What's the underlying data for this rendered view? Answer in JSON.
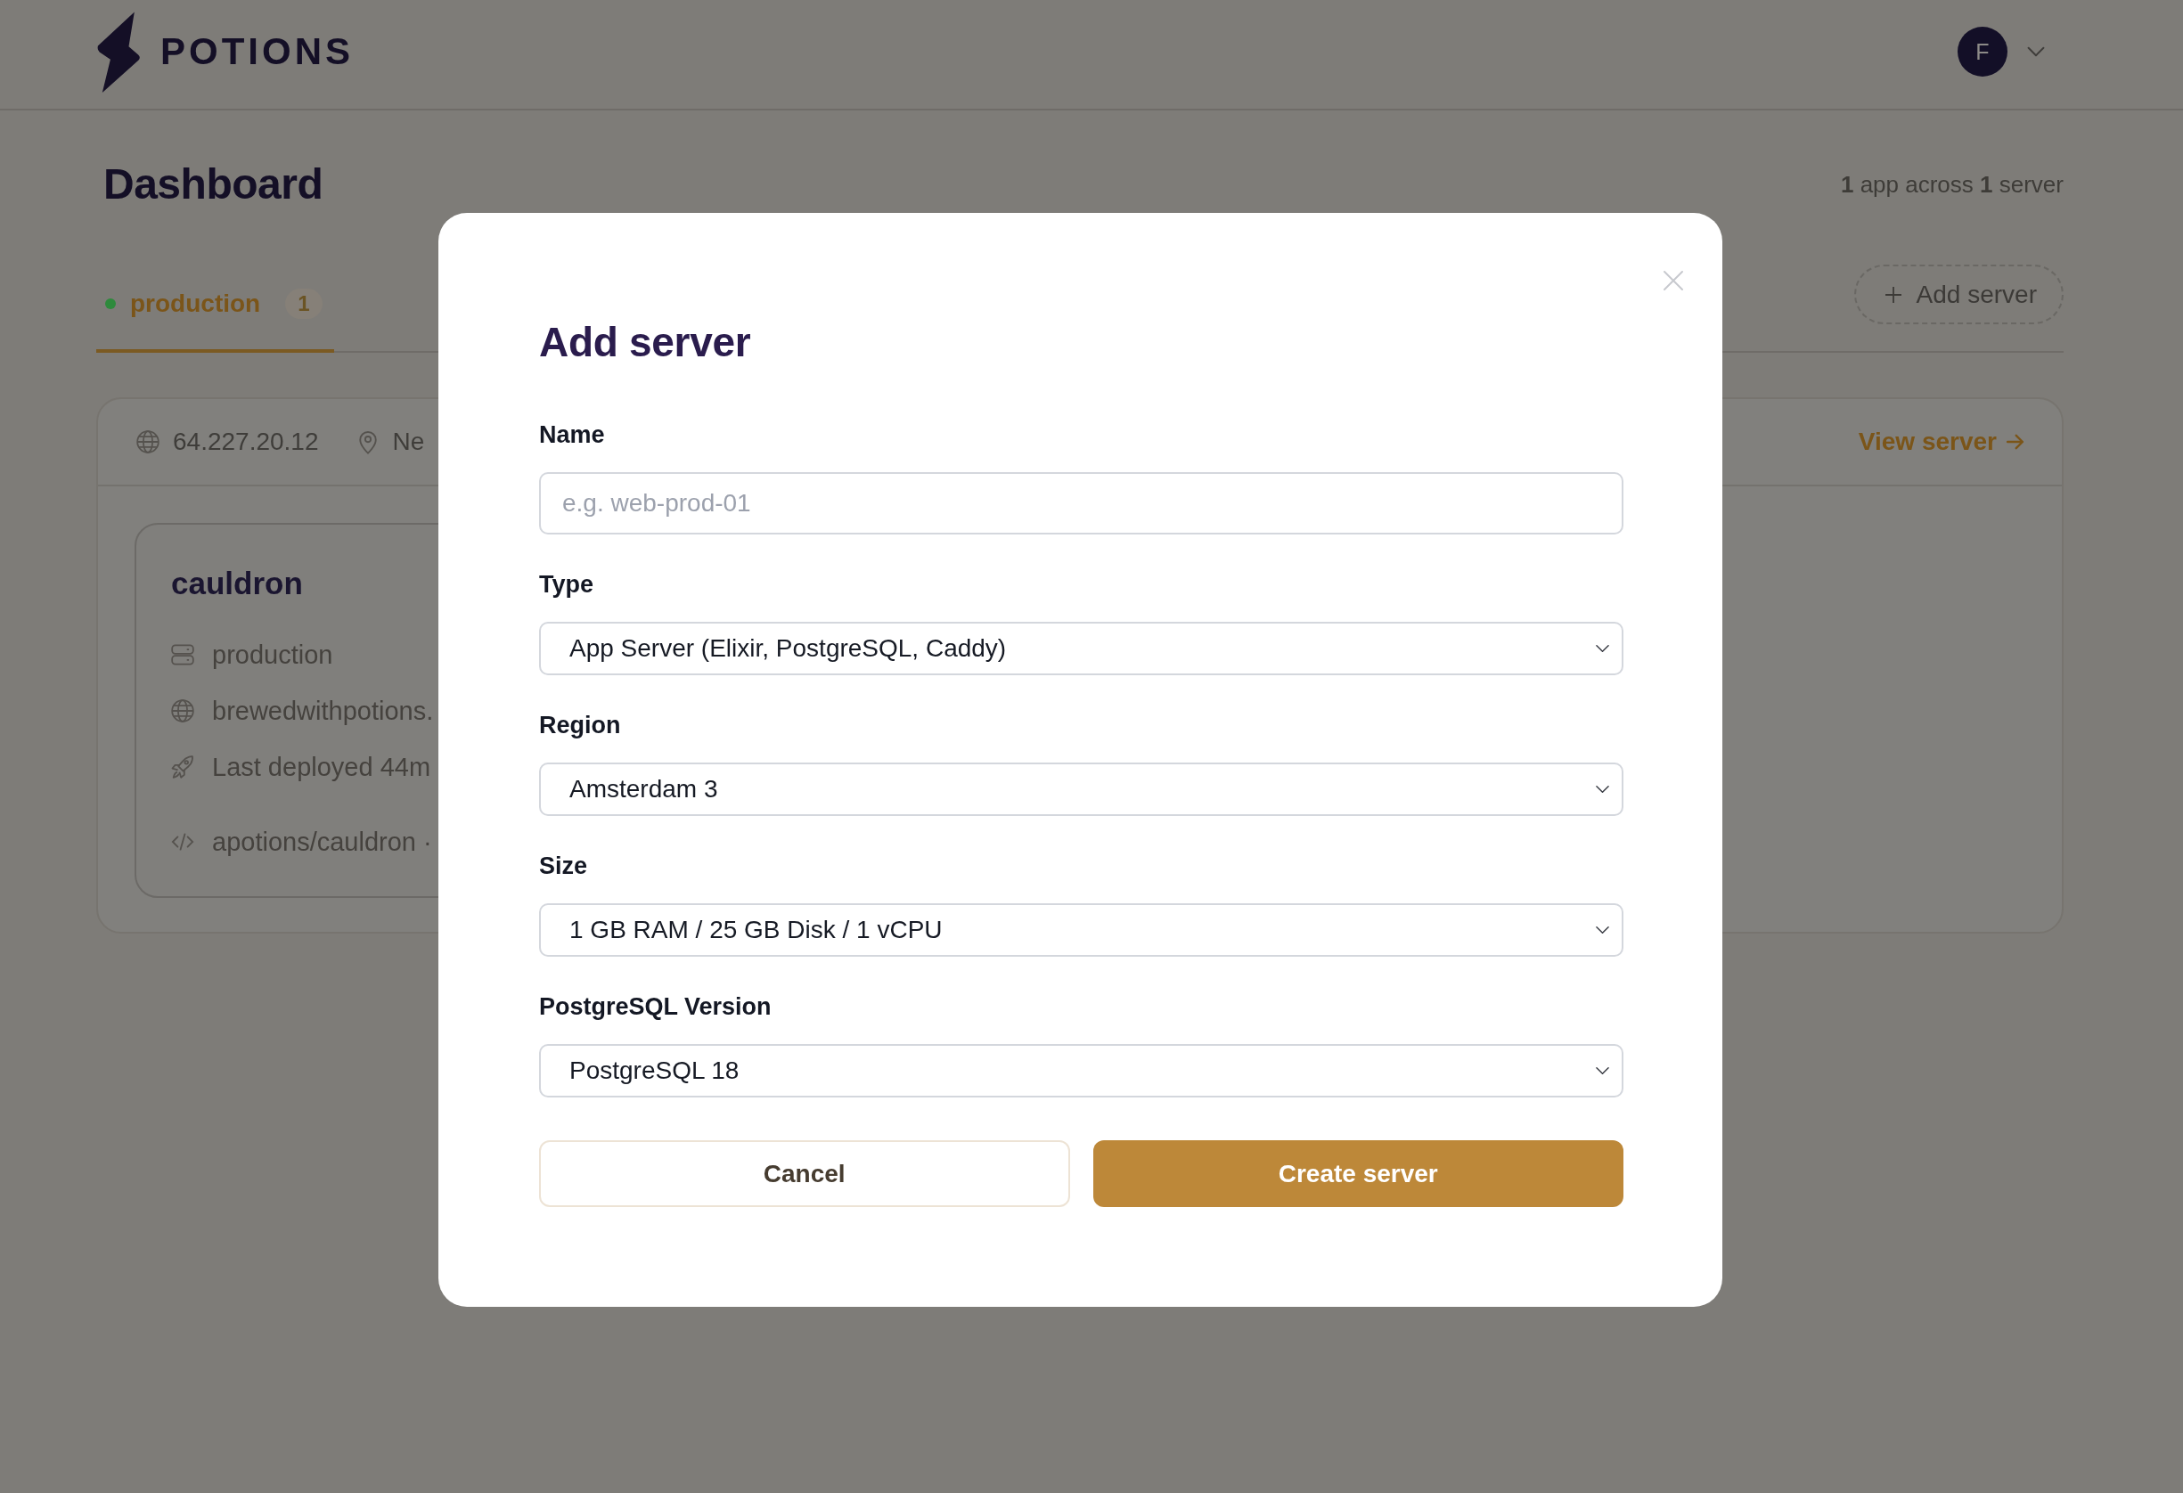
{
  "header": {
    "logo": "POTIONS",
    "avatar": "F"
  },
  "dashboard": {
    "title": "Dashboard",
    "summary": "**1** app across **1** server"
  },
  "tabs": [
    {
      "label": "production",
      "count": "1",
      "color": "#2e8a3c",
      "selected": true
    }
  ],
  "add_server_button": {
    "label": "Add server"
  },
  "server_card": {
    "ip": "64.227.20.12",
    "location": "Ne",
    "link": "View server",
    "apps": [
      {
        "name": "cauldron",
        "rows": [
          {
            "kind": "environment",
            "text": "production"
          },
          {
            "kind": "domain",
            "text": "brewedwithpotions."
          },
          {
            "kind": "deploy",
            "text": "Last deployed 44m"
          },
          {
            "kind": "repo",
            "text": "apotions/cauldron ·"
          }
        ]
      }
    ]
  },
  "modal": {
    "title": "Add server",
    "fields": [
      {
        "kind": "text",
        "label": "Name",
        "placeholder": "e.g. web-prod-01"
      },
      {
        "kind": "select",
        "label": "Type",
        "value": "App Server (Elixir, PostgreSQL, Caddy)"
      },
      {
        "kind": "select",
        "label": "Region",
        "value": "Amsterdam 3"
      },
      {
        "kind": "select",
        "label": "Size",
        "value": "1 GB RAM / 25 GB Disk / 1 vCPU"
      },
      {
        "kind": "select",
        "label": "PostgreSQL Version",
        "value": "PostgreSQL 18"
      }
    ],
    "buttons": [
      {
        "kind": "secondary",
        "label": "Cancel"
      },
      {
        "kind": "primary",
        "label": "Create server"
      }
    ]
  }
}
